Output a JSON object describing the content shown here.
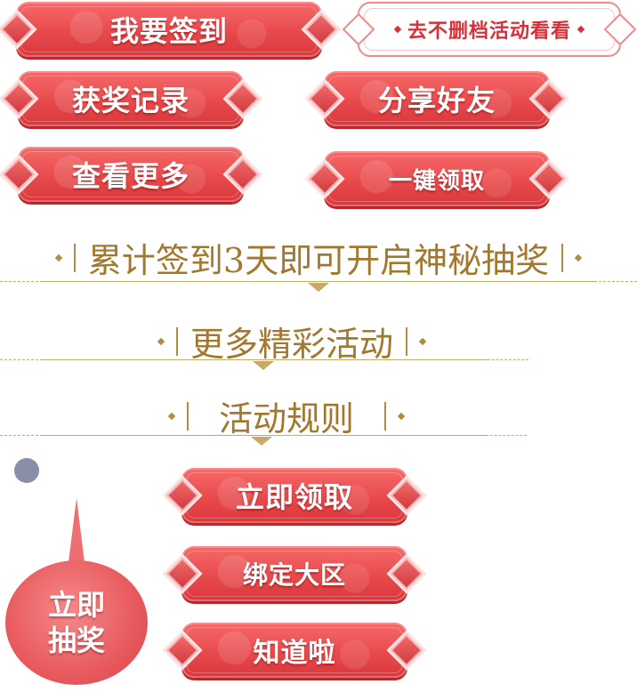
{
  "buttons": {
    "sign_in": "我要签到",
    "no_delete": "去不删档活动看看",
    "prize_record": "获奖记录",
    "share_friend": "分享好友",
    "see_more": "查看更多",
    "one_click_claim": "一键领取",
    "claim_now": "立即领取",
    "bind_region": "绑定大区",
    "got_it": "知道啦"
  },
  "headings": {
    "cumulative": "累计签到3天即可开启神秘抽奖",
    "more_events": "更多精彩活动",
    "rules": "活动规则"
  },
  "lottery": {
    "line1": "立即",
    "line2": "抽奖"
  },
  "colors": {
    "button_red": "#e84a4c",
    "gold": "#a2782e",
    "indicator_gray": "#8a8fa8"
  }
}
